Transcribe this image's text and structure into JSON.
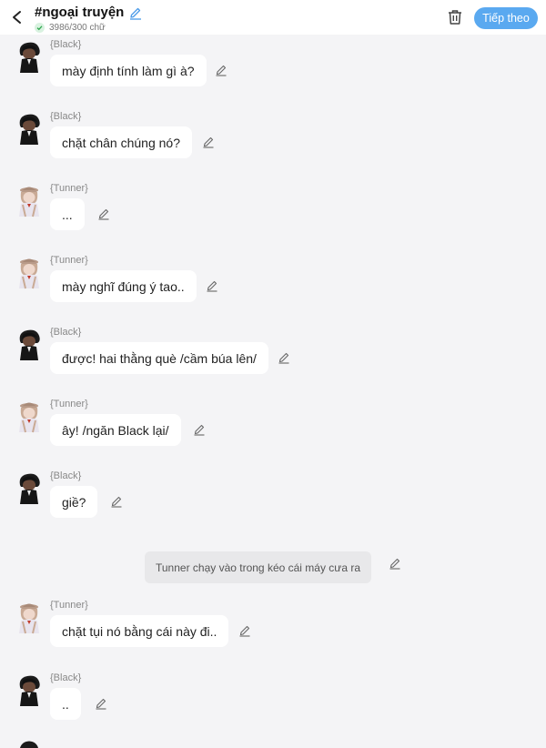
{
  "header": {
    "title": "#ngoại truyện",
    "count": "3986/300 chữ",
    "next_label": "Tiếp theo"
  },
  "messages": [
    {
      "speaker": "{Black}",
      "text": "mày định tính làm gì à?",
      "avatar": "black"
    },
    {
      "speaker": "{Black}",
      "text": "chặt chân chúng nó?",
      "avatar": "black"
    },
    {
      "speaker": "{Tunner}",
      "text": "...",
      "avatar": "tunner"
    },
    {
      "speaker": "{Tunner}",
      "text": "mày nghĩ đúng ý tao..",
      "avatar": "tunner"
    },
    {
      "speaker": "{Black}",
      "text": "được! hai thằng què /cầm búa lên/",
      "avatar": "black"
    },
    {
      "speaker": "{Tunner}",
      "text": "ây! /ngăn Black lại/",
      "avatar": "tunner"
    },
    {
      "speaker": "{Black}",
      "text": "giề?",
      "avatar": "black"
    },
    {
      "speaker": "{Tunner}",
      "text": "chặt tụi nó bằng cái này đi..",
      "avatar": "tunner"
    },
    {
      "speaker": "{Black}",
      "text": "..",
      "avatar": "black"
    }
  ],
  "narration": "Tunner chạy vào trong kéo cái máy cưa ra",
  "colors": {
    "accent": "#5aa9f0",
    "background": "#f4f4f6",
    "bubble": "#ffffff"
  }
}
